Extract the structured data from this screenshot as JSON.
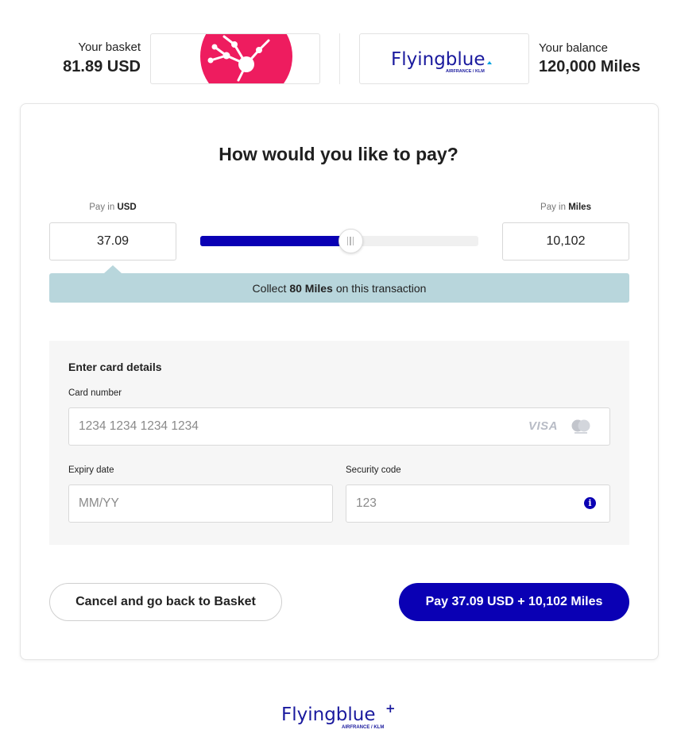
{
  "header": {
    "basket_label": "Your basket",
    "basket_value": "81.89 USD",
    "balance_label": "Your balance",
    "balance_value": "120,000 Miles",
    "merchant_logo": "merchant-network-logo",
    "partner_logo": "flyingblue-logo",
    "partner_logo_text": "Flyingblue",
    "partner_logo_subtext": "AIRFRANCE / KLM"
  },
  "payment": {
    "title": "How would you like to pay?",
    "usd_label_prefix": "Pay in",
    "usd_label_currency": "USD",
    "miles_label_prefix": "Pay in",
    "miles_label_currency": "Miles",
    "usd_amount": "37.09",
    "miles_amount": "10,102",
    "slider_fraction": 0.54,
    "collect_prefix": "Collect",
    "collect_miles": "80 Miles",
    "collect_suffix": "on this transaction"
  },
  "card": {
    "section_title": "Enter card details",
    "number_label": "Card number",
    "number_placeholder": "1234 1234 1234 1234",
    "expiry_label": "Expiry date",
    "expiry_placeholder": "MM/YY",
    "security_label": "Security code",
    "security_placeholder": "123",
    "brand_visa": "VISA",
    "icons": [
      "visa-icon",
      "mastercard-icon",
      "info-icon"
    ]
  },
  "actions": {
    "cancel_label": "Cancel and go back to Basket",
    "pay_label": "Pay 37.09 USD + 10,102 Miles"
  },
  "footer": {
    "logo_text": "Flyingblue",
    "logo_plus": "+",
    "logo_subtext": "AIRFRANCE / KLM"
  },
  "colors": {
    "brand": "#0a00b4",
    "banner": "#b8d6dc",
    "merchant_logo": "#ee1c5f"
  }
}
